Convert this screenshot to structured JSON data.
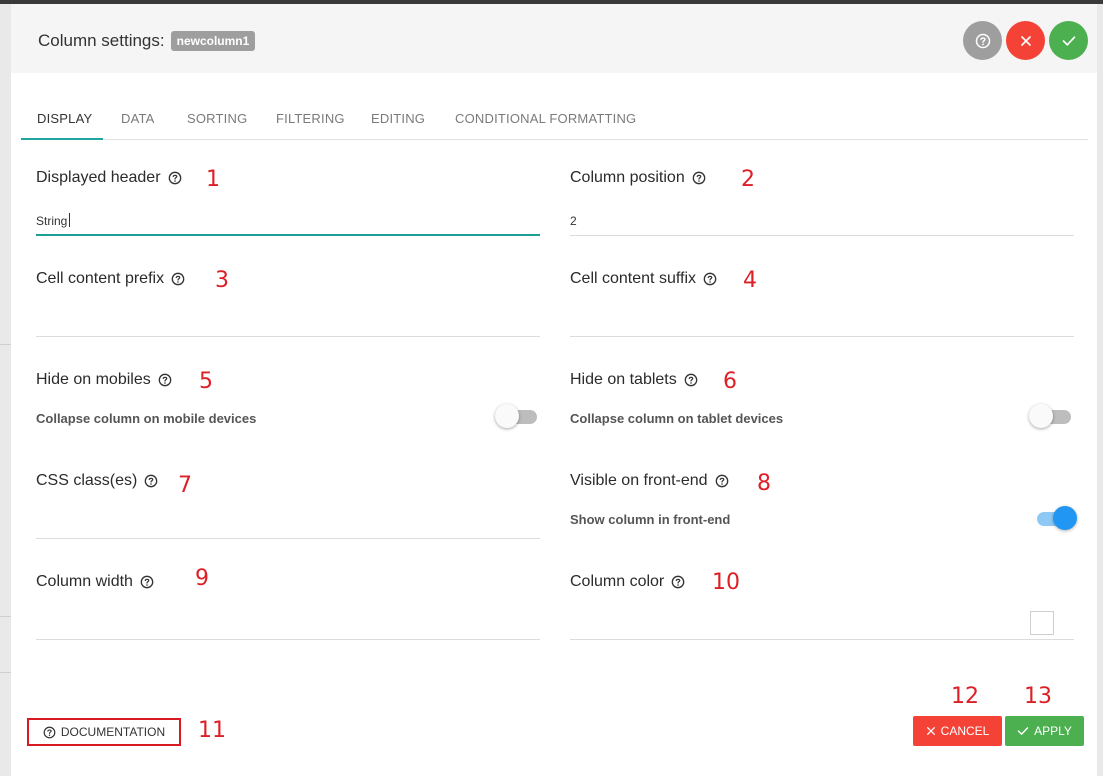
{
  "header": {
    "title": "Column settings:",
    "column_badge": "newcolumn1",
    "buttons": [
      {
        "icon": "help-circle-icon",
        "color": "#9e9e9e"
      },
      {
        "icon": "close-icon",
        "color": "#f44336"
      },
      {
        "icon": "check-icon",
        "color": "#4caf50"
      }
    ]
  },
  "tabs": [
    {
      "label": "DISPLAY",
      "active": true
    },
    {
      "label": "DATA",
      "active": false
    },
    {
      "label": "SORTING",
      "active": false
    },
    {
      "label": "FILTERING",
      "active": false
    },
    {
      "label": "EDITING",
      "active": false
    },
    {
      "label": "CONDITIONAL FORMATTING",
      "active": false
    }
  ],
  "fields": {
    "displayed_header": {
      "label": "Displayed header",
      "value": "String",
      "marker": "1"
    },
    "column_position": {
      "label": "Column position",
      "value": "2",
      "marker": "2"
    },
    "cell_prefix": {
      "label": "Cell content prefix",
      "value": "",
      "marker": "3"
    },
    "cell_suffix": {
      "label": "Cell content suffix",
      "value": "",
      "marker": "4"
    },
    "hide_mobiles": {
      "label": "Hide on mobiles",
      "description": "Collapse column on mobile devices",
      "enabled": false,
      "marker": "5"
    },
    "hide_tablets": {
      "label": "Hide on tablets",
      "description": "Collapse column on tablet devices",
      "enabled": false,
      "marker": "6"
    },
    "css_classes": {
      "label": "CSS class(es)",
      "value": "",
      "marker": "7"
    },
    "visible_frontend": {
      "label": "Visible on front-end",
      "description": "Show column in front-end",
      "enabled": true,
      "marker": "8"
    },
    "column_width": {
      "label": "Column width",
      "value": "",
      "marker": "9"
    },
    "column_color": {
      "label": "Column color",
      "value": "#ffffff",
      "marker": "10"
    }
  },
  "footer": {
    "documentation_label": "DOCUMENTATION",
    "documentation_marker": "11",
    "cancel_label": "CANCEL",
    "cancel_marker": "12",
    "cancel_color": "#f44336",
    "apply_label": "APPLY",
    "apply_marker": "13",
    "apply_color": "#4caf50"
  },
  "colors": {
    "accent": "#20a6a0",
    "marker_red": "#dd1f26",
    "toggle_on": "#2196f3"
  }
}
